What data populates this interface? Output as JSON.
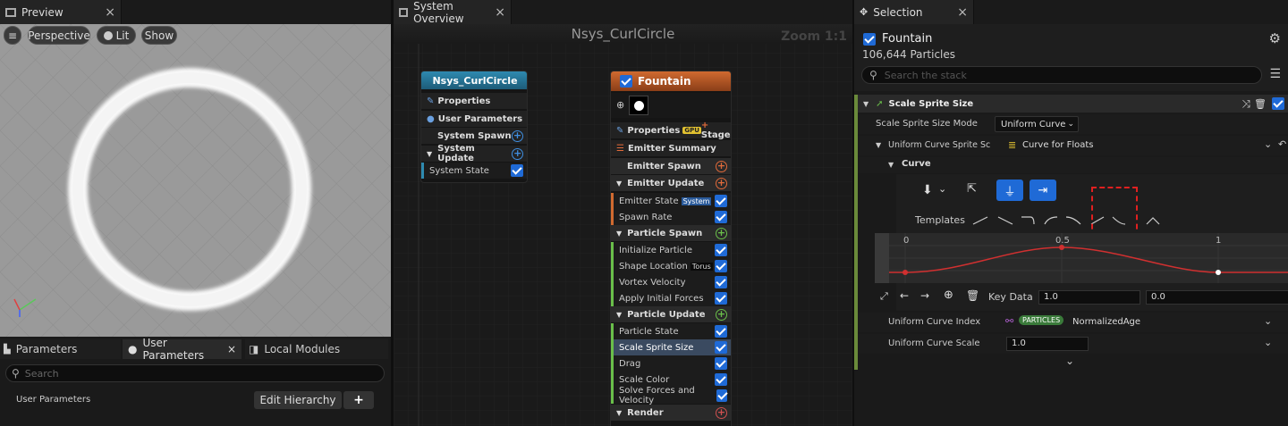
{
  "preview": {
    "tab_label": "Preview",
    "buttons": {
      "perspective": "Perspective",
      "lit": "Lit",
      "show": "Show"
    }
  },
  "bottom_left": {
    "tabs": [
      "Parameters",
      "User Parameters",
      "Local Modules"
    ],
    "search_placeholder": "Search",
    "section_label": "User Parameters",
    "edit_hierarchy": "Edit Hierarchy",
    "add": "+"
  },
  "overview": {
    "tab_label": "System Overview",
    "title": "Nsys_CurlCircle",
    "zoom": "Zoom 1:1",
    "system_node": {
      "title": "Nsys_CurlCircle",
      "rows": [
        "Properties",
        "User Parameters",
        "System Spawn",
        "System Update",
        "System State"
      ]
    },
    "emitter_node": {
      "title": "Fountain",
      "properties": "Properties",
      "gpu_badge": "GPU",
      "stage": "Stage",
      "emitter_summary": "Emitter Summary",
      "emitter_spawn": "Emitter Spawn",
      "emitter_update": "Emitter Update",
      "emitter_state": "Emitter State",
      "system_badge": "System",
      "spawn_rate": "Spawn Rate",
      "particle_spawn": "Particle Spawn",
      "initialize_particle": "Initialize Particle",
      "shape_location": "Shape Location",
      "torus_badge": "Torus",
      "vortex_velocity": "Vortex Velocity",
      "apply_initial_forces": "Apply Initial Forces",
      "particle_update": "Particle Update",
      "particle_state": "Particle State",
      "scale_sprite_size": "Scale Sprite Size",
      "drag": "Drag",
      "scale_color": "Scale Color",
      "solve_forces": "Solve Forces and Velocity",
      "render": "Render"
    }
  },
  "selection": {
    "tab_label": "Selection",
    "name": "Fountain",
    "particles": "106,644 Particles",
    "search_placeholder": "Search the stack",
    "module_title": "Scale Sprite Size",
    "mode_label": "Scale Sprite Size Mode",
    "mode_value": "Uniform Curve",
    "curve_label": "Uniform Curve Sprite Scale",
    "curve_value": "Curve for Floats",
    "curve_section": "Curve",
    "templates_label": "Templates",
    "axis_ticks": [
      "0",
      "0.5",
      "1"
    ],
    "key_data_label": "Key Data",
    "key_data_value1": "1.0",
    "key_data_value2": "0.0",
    "index_label": "Uniform Curve Index",
    "index_badge": "PARTICLES",
    "index_value": "NormalizedAge",
    "scale_label": "Uniform Curve Scale",
    "scale_value": "1.0"
  }
}
